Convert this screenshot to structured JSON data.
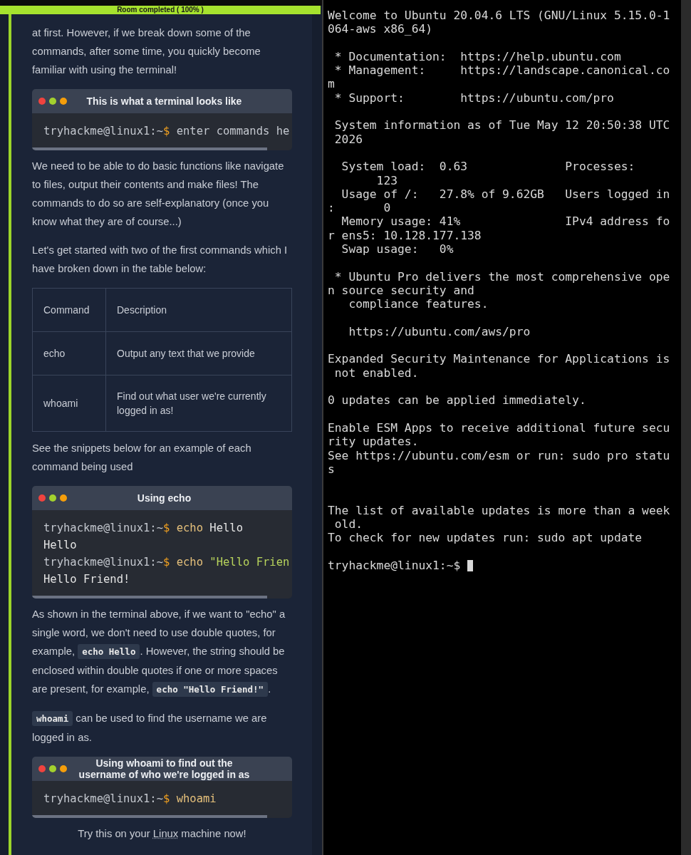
{
  "progress": {
    "label": "Room completed ( 100% )",
    "level": 1
  },
  "content": [
    {
      "kind": "paragraph",
      "segments": [
        {
          "kind": "text",
          "text": "at first. However, if we break down some of the commands, after some time, you quickly become familiar with using the terminal!"
        }
      ]
    },
    {
      "kind": "snippet",
      "title": "This is what a terminal looks like",
      "lines": [
        [
          {
            "kind": "prompt",
            "text": "tryhackme@linux1:~"
          },
          {
            "kind": "dollar",
            "text": "$"
          },
          {
            "kind": "hint",
            "text": " enter commands he"
          }
        ]
      ]
    },
    {
      "kind": "paragraph",
      "segments": [
        {
          "kind": "text",
          "text": "We need to be able to do basic functions like navigate to files, output their contents and make files! The commands to do so are self-explanatory (once you know what they are of course...)"
        }
      ]
    },
    {
      "kind": "paragraph",
      "segments": [
        {
          "kind": "text",
          "text": "Let's get started with two of the first commands which I have broken down in the table below:"
        }
      ]
    },
    {
      "kind": "table",
      "columns": [
        "Command",
        "Description"
      ],
      "rows": [
        [
          "echo",
          "Output any text that we provide"
        ],
        [
          "whoami",
          "Find out what user we're currently logged in as!"
        ]
      ]
    },
    {
      "kind": "paragraph",
      "segments": [
        {
          "kind": "text",
          "text": "See the snippets below for an example of each command being used"
        }
      ]
    },
    {
      "kind": "snippet",
      "title": "Using echo",
      "lines": [
        [
          {
            "kind": "prompt",
            "text": "tryhackme@linux1:~"
          },
          {
            "kind": "dollar",
            "text": "$"
          },
          {
            "kind": "command",
            "text": " echo"
          },
          {
            "kind": "output",
            "text": " Hello"
          }
        ],
        [
          {
            "kind": "output",
            "text": "Hello"
          }
        ],
        [
          {
            "kind": "prompt",
            "text": "tryhackme@linux1:~"
          },
          {
            "kind": "dollar",
            "text": "$"
          },
          {
            "kind": "command",
            "text": " echo"
          },
          {
            "kind": "string",
            "text": " \"Hello Frien"
          }
        ],
        [
          {
            "kind": "output",
            "text": "Hello Friend!"
          }
        ]
      ]
    },
    {
      "kind": "paragraph",
      "segments": [
        {
          "kind": "text",
          "text": "As shown in the terminal above, if we want to \"echo\" a single word, we don't need to use double quotes, for example, "
        },
        {
          "kind": "code",
          "text": "echo Hello"
        },
        {
          "kind": "text",
          "text": ". However, the string should be enclosed within double quotes if one or more spaces are present, for example, "
        },
        {
          "kind": "code",
          "text": "echo \"Hello Friend!\""
        },
        {
          "kind": "text",
          "text": "."
        }
      ]
    },
    {
      "kind": "paragraph",
      "segments": [
        {
          "kind": "code",
          "text": "whoami"
        },
        {
          "kind": "text",
          "text": " can be used to find the username we are logged in as."
        }
      ]
    },
    {
      "kind": "snippet",
      "title": "Using whoami to find out the username of who we're logged in as",
      "lines": [
        [
          {
            "kind": "prompt",
            "text": "tryhackme@linux1:~"
          },
          {
            "kind": "dollar",
            "text": "$"
          },
          {
            "kind": "command",
            "text": " whoami"
          }
        ]
      ]
    },
    {
      "kind": "note",
      "segments": [
        {
          "kind": "text",
          "text": "Try this on your "
        },
        {
          "kind": "link",
          "text": "Linux"
        },
        {
          "kind": "text",
          "text": " machine now!"
        }
      ]
    }
  ],
  "terminal": {
    "output": "Welcome to Ubuntu 20.04.6 LTS (GNU/Linux 5.15.0-1\n064-aws x86_64)\n\n * Documentation:  https://help.ubuntu.com\n * Management:     https://landscape.canonical.co\nm\n * Support:        https://ubuntu.com/pro\n\n System information as of Tue May 12 20:50:38 UTC\n 2026\n\n  System load:  0.63              Processes:\n       123\n  Usage of /:   27.8% of 9.62GB   Users logged in\n:       0\n  Memory usage: 41%               IPv4 address fo\nr ens5: 10.128.177.138\n  Swap usage:   0%\n\n * Ubuntu Pro delivers the most comprehensive ope\nn source security and\n   compliance features.\n\n   https://ubuntu.com/aws/pro\n\nExpanded Security Maintenance for Applications is\n not enabled.\n\n0 updates can be applied immediately.\n\nEnable ESM Apps to receive additional future secu\nrity updates.\nSee https://ubuntu.com/esm or run: sudo pro statu\ns\n\n\nThe list of available updates is more than a week\n old.\nTo check for new updates run: sudo apt update",
    "prompt": "tryhackme@linux1:~$ "
  }
}
